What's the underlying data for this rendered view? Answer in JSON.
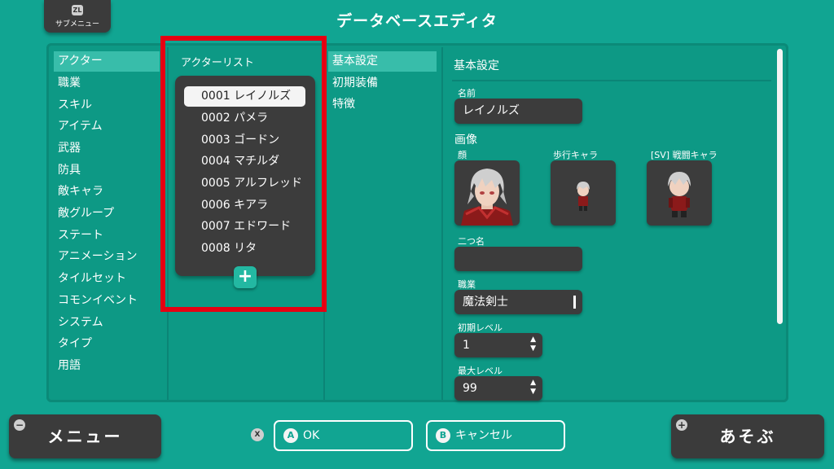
{
  "header": {
    "submenu_badge": "ZL",
    "submenu_label": "サブメニュー",
    "title": "データベースエディタ"
  },
  "categories": [
    {
      "label": "アクター",
      "selected": true
    },
    {
      "label": "職業"
    },
    {
      "label": "スキル"
    },
    {
      "label": "アイテム"
    },
    {
      "label": "武器"
    },
    {
      "label": "防具"
    },
    {
      "label": "敵キャラ"
    },
    {
      "label": "敵グループ"
    },
    {
      "label": "ステート"
    },
    {
      "label": "アニメーション"
    },
    {
      "label": "タイルセット"
    },
    {
      "label": "コモンイベント"
    },
    {
      "label": "システム"
    },
    {
      "label": "タイプ"
    },
    {
      "label": "用語"
    }
  ],
  "actor_list": {
    "heading": "アクターリスト",
    "items": [
      {
        "label": "0001 レイノルズ",
        "selected": true
      },
      {
        "label": "0002 パメラ"
      },
      {
        "label": "0003 ゴードン"
      },
      {
        "label": "0004 マチルダ"
      },
      {
        "label": "0005 アルフレッド"
      },
      {
        "label": "0006 キアラ"
      },
      {
        "label": "0007 エドワード"
      },
      {
        "label": "0008 リタ"
      }
    ],
    "add_glyph": "+"
  },
  "sub_tabs": [
    {
      "label": "基本設定",
      "selected": true
    },
    {
      "label": "初期装備"
    },
    {
      "label": "特徴"
    }
  ],
  "settings": {
    "heading": "基本設定",
    "name_label": "名前",
    "name_value": "レイノルズ",
    "images_label": "画像",
    "face_label": "顔",
    "walk_label": "歩行キャラ",
    "battler_label": "[SV] 戦闘キャラ",
    "nickname_label": "二つ名",
    "nickname_value": "",
    "class_label": "職業",
    "class_value": "魔法剣士",
    "initial_level_label": "初期レベル",
    "initial_level_value": "1",
    "max_level_label": "最大レベル",
    "max_level_value": "99",
    "stepper_up": "▲",
    "stepper_down": "▼"
  },
  "footer": {
    "menu_glyph": "−",
    "menu_label": "メニュー",
    "x_badge": "X",
    "ok_letter": "A",
    "ok_label": "OK",
    "cancel_letter": "B",
    "cancel_label": "キャンセル",
    "play_glyph": "+",
    "play_label": "あそぶ"
  },
  "colors": {
    "background": "#11a592",
    "panel": "#0d9985",
    "dark_box": "#3c3c3c",
    "selected_row": "#38bdaa",
    "highlight_border": "#e60012"
  }
}
